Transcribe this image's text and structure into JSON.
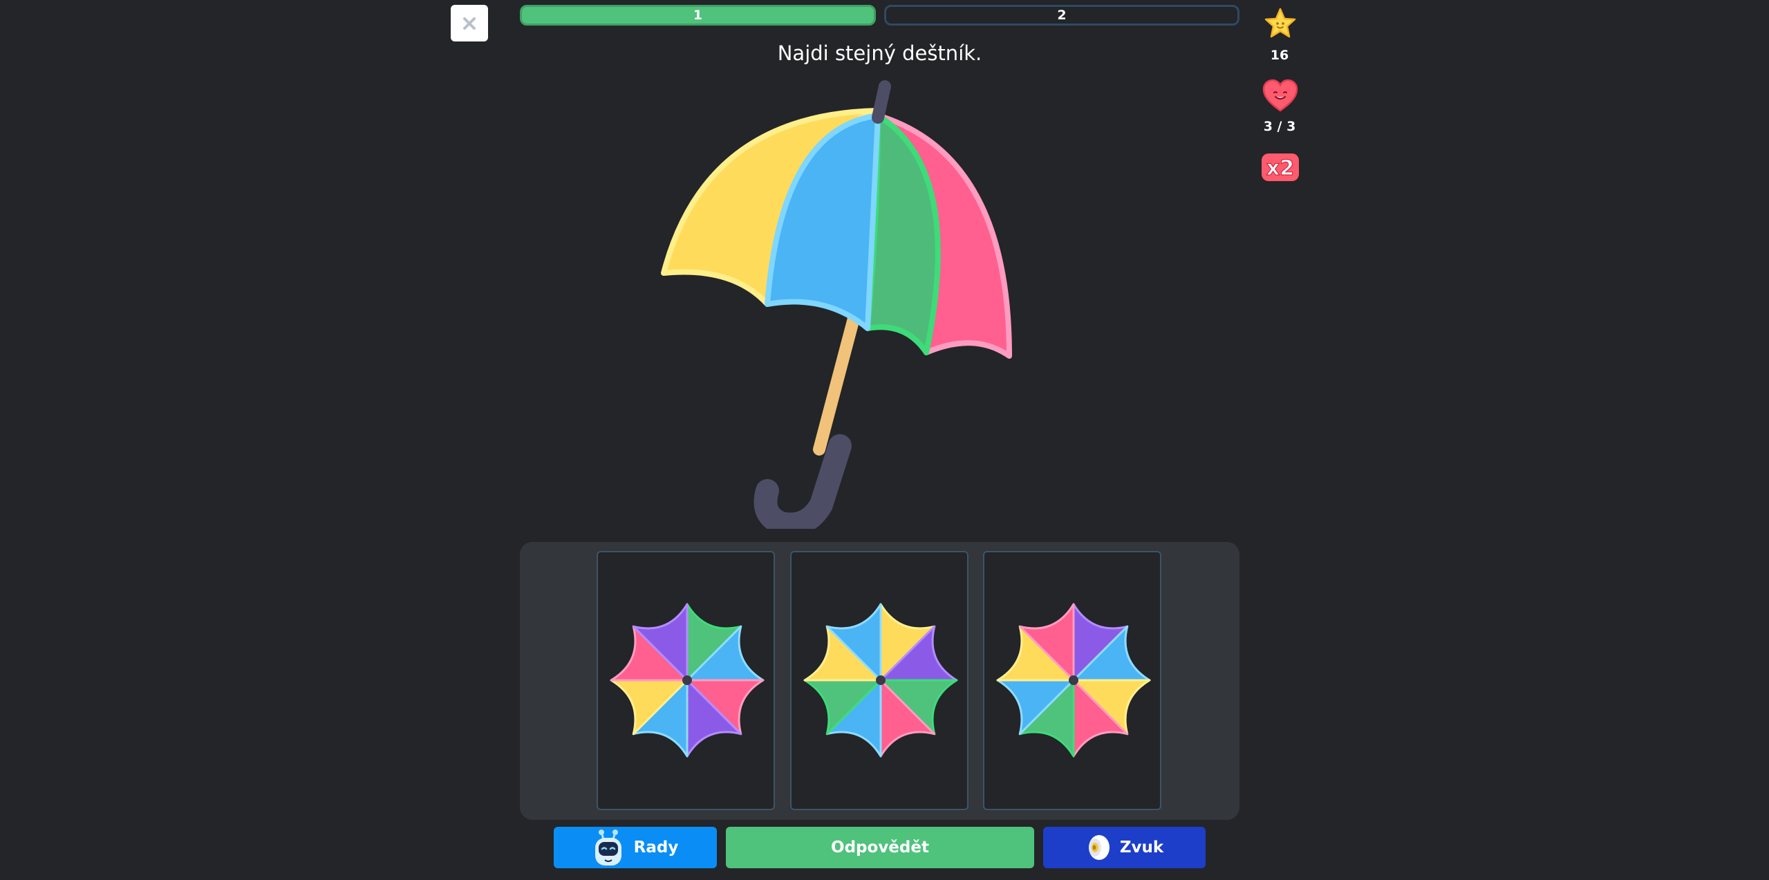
{
  "header": {
    "close_label": "×",
    "progress": [
      {
        "label": "1",
        "state": "complete"
      },
      {
        "label": "2",
        "state": "pending"
      }
    ]
  },
  "prompt": "Najdi stejný deštník.",
  "stats": {
    "stars": "16",
    "lives": "3 / 3",
    "multiplier": "x2"
  },
  "choices": [
    {
      "label": "umbrella-option-1",
      "colors": [
        "#4fc27c",
        "#4ab4f5",
        "#ff6090",
        "#8b5be8",
        "#4ab4f5",
        "#ffdb5c",
        "#ff6090",
        "#8b5be8"
      ]
    },
    {
      "label": "umbrella-option-2",
      "colors": [
        "#ffdb5c",
        "#8b5be8",
        "#4fc27c",
        "#ff6090",
        "#4ab4f5",
        "#4fc27c",
        "#ffdb5c",
        "#4ab4f5"
      ]
    },
    {
      "label": "umbrella-option-3",
      "colors": [
        "#8b5be8",
        "#4ab4f5",
        "#ffdb5c",
        "#ff6090",
        "#4fc27c",
        "#4ab4f5",
        "#ffdb5c",
        "#ff6090"
      ]
    }
  ],
  "buttons": {
    "hints": "Rady",
    "answer": "Odpovědět",
    "sound": "Zvuk"
  },
  "colors": {
    "background": "#232528",
    "progress_complete": "#4fc27c",
    "hints_button": "#0a8ef5",
    "answer_button": "#4fc27c",
    "sound_button": "#1c3ec9"
  }
}
